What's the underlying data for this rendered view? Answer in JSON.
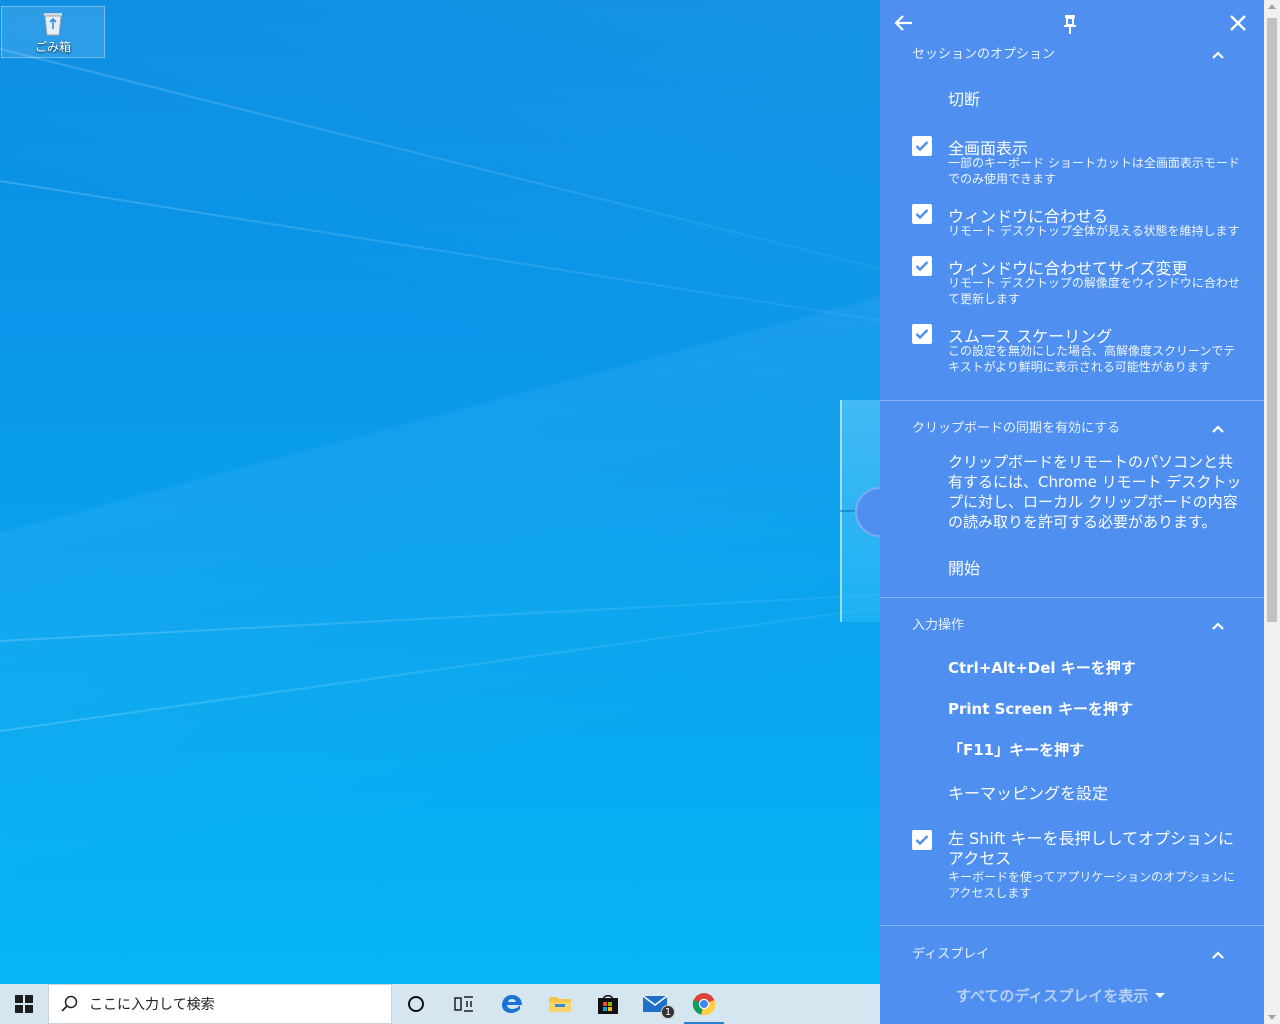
{
  "desktop": {
    "recycle_bin_label": "ごみ箱"
  },
  "taskbar": {
    "search_placeholder": "ここに入力して検索",
    "mail_badge": "1",
    "icons": [
      "windows-start-icon",
      "search-icon",
      "cortana-icon",
      "task-view-icon",
      "edge-icon",
      "file-explorer-icon",
      "store-icon",
      "mail-icon",
      "chrome-icon"
    ]
  },
  "panel": {
    "session": {
      "title": "セッションのオプション",
      "disconnect": "切断",
      "fullscreen": {
        "label": "全画面表示",
        "desc": "一部のキーボード ショートカットは全画面表示モードでのみ使用できます",
        "checked": true
      },
      "fit_window": {
        "label": "ウィンドウに合わせる",
        "desc": "リモート デスクトップ全体が見える状態を維持します",
        "checked": true
      },
      "resize_to_window": {
        "label": "ウィンドウに合わせてサイズ変更",
        "desc": "リモート デスクトップの解像度をウィンドウに合わせて更新します",
        "checked": true
      },
      "smooth_scaling": {
        "label": "スムース スケーリング",
        "desc": "この設定を無効にした場合、高解像度スクリーンでテキストがより鮮明に表示される可能性があります",
        "checked": true
      }
    },
    "clipboard": {
      "title": "クリップボードの同期を有効にする",
      "desc": "クリップボードをリモートのパソコンと共有するには、Chrome リモート デスクトップに対し、ローカル クリップボードの内容の読み取りを許可する必要があります。",
      "start": "開始"
    },
    "input": {
      "title": "入力操作",
      "ctrl_alt_del": "Ctrl+Alt+Del キーを押す",
      "print_screen": "Print Screen キーを押す",
      "f11": "「F11」キーを押す",
      "key_mapping": "キーマッピングを設定",
      "shift_access": {
        "label": "左 Shift キーを長押ししてオプションにアクセス",
        "desc": "キーボードを使ってアプリケーションのオプションにアクセスします",
        "checked": true
      }
    },
    "display": {
      "title": "ディスプレイ",
      "show_all": "すべてのディスプレイを表示"
    }
  },
  "colors": {
    "panel_bg": "#4e8ff0",
    "desktop_blue": "#0a97ea",
    "taskbar_bg": "#d6e6f0"
  }
}
